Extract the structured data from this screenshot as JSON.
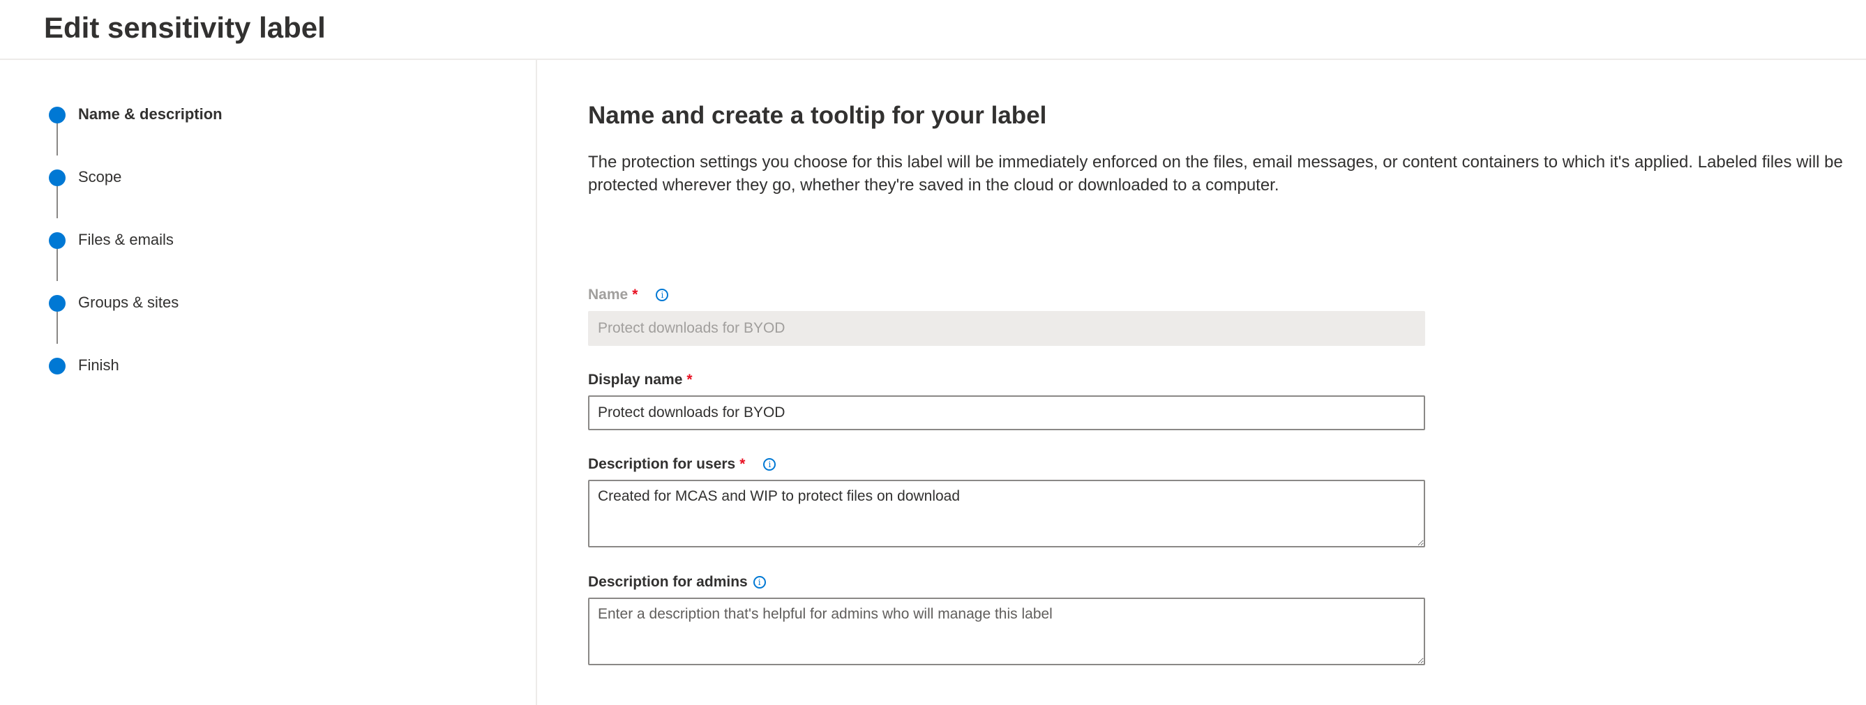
{
  "header": {
    "title": "Edit sensitivity label"
  },
  "wizard": {
    "steps": [
      {
        "label": "Name & description",
        "active": true
      },
      {
        "label": "Scope",
        "active": false
      },
      {
        "label": "Files & emails",
        "active": false
      },
      {
        "label": "Groups & sites",
        "active": false
      },
      {
        "label": "Finish",
        "active": false
      }
    ],
    "step_color": "#0078d4"
  },
  "main": {
    "title": "Name and create a tooltip for your label",
    "description": "The protection settings you choose for this label will be immediately enforced on the files, email messages, or content containers to which it's applied. Labeled files will be protected wherever they go, whether they're saved in the cloud or downloaded to a computer.",
    "fields": {
      "name": {
        "label": "Name",
        "required_marker": "*",
        "value": "Protect downloads for BYOD",
        "disabled": true
      },
      "display_name": {
        "label": "Display name",
        "required_marker": "*",
        "value": "Protect downloads for BYOD"
      },
      "description_users": {
        "label": "Description for users",
        "required_marker": "*",
        "value": "Created for MCAS and WIP to protect files on download"
      },
      "description_admins": {
        "label": "Description for admins",
        "value": "",
        "placeholder": "Enter a description that's helpful for admins who will manage this label"
      }
    },
    "icons": {
      "info": "info-icon",
      "info_glyph": "i"
    }
  }
}
